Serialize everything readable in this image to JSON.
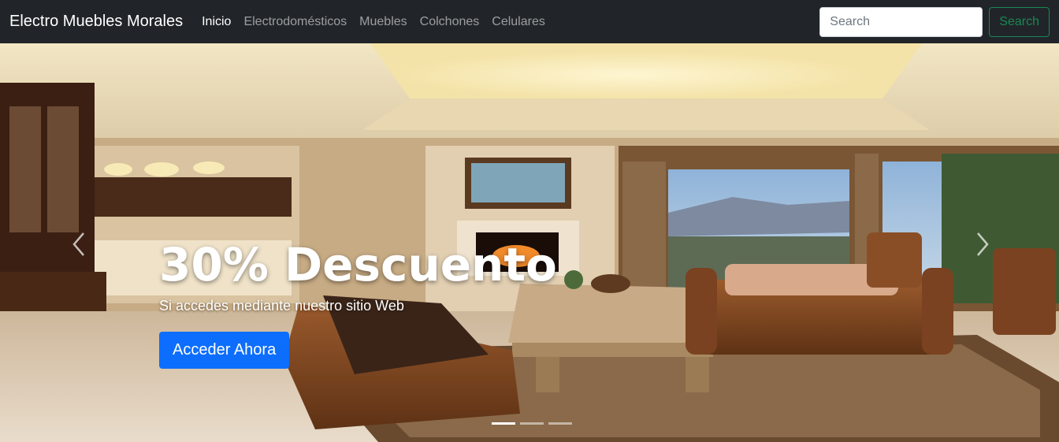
{
  "navbar": {
    "brand": "Electro Muebles Morales",
    "links": [
      {
        "label": "Inicio",
        "active": true
      },
      {
        "label": "Electrodomésticos",
        "active": false
      },
      {
        "label": "Muebles",
        "active": false
      },
      {
        "label": "Colchones",
        "active": false
      },
      {
        "label": "Celulares",
        "active": false
      }
    ],
    "search_placeholder": "Search",
    "search_button": "Search"
  },
  "carousel": {
    "title": "30% Descuento",
    "subtitle": "Si accedes mediante nuestro sitio Web",
    "cta_label": "Acceder Ahora",
    "prev_icon": "chevron-left-icon",
    "next_icon": "chevron-right-icon",
    "active_slide": 1,
    "slide_count": 3
  },
  "colors": {
    "navbar_bg": "#212529",
    "primary": "#0d6efd",
    "success": "#198754"
  }
}
